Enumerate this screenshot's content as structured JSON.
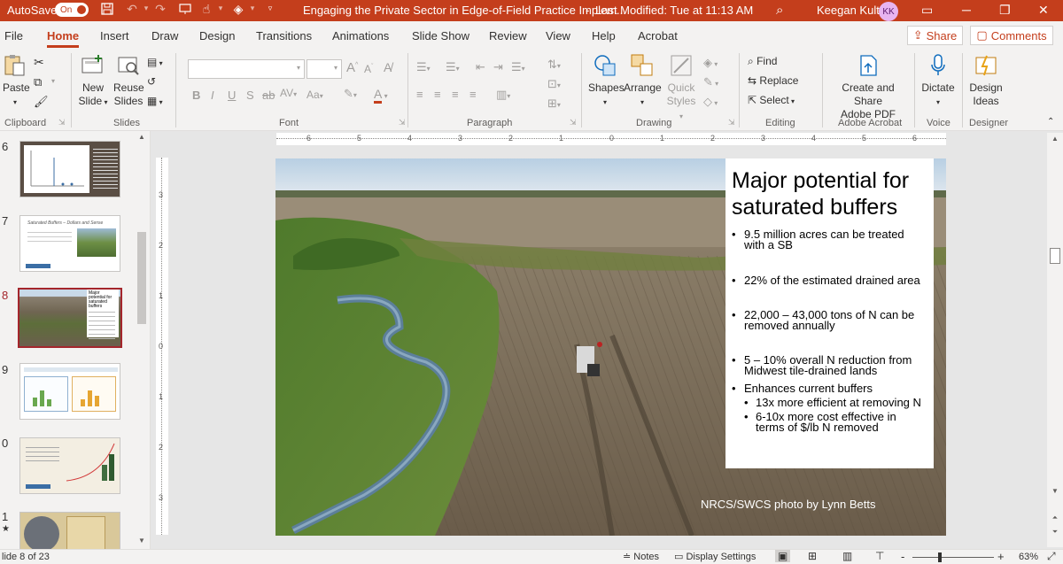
{
  "titlebar": {
    "autosave_label": "AutoSave",
    "autosave_state": "On",
    "doc_title": "Engaging the Private Sector in Edge-of-Field Practice Implem...",
    "sep": "-",
    "last_modified": "Last Modified: Tue at 11:13 AM",
    "user_name": "Keegan Kult",
    "user_initials": "KK"
  },
  "tabs": [
    "File",
    "Home",
    "Insert",
    "Draw",
    "Design",
    "Transitions",
    "Animations",
    "Slide Show",
    "Review",
    "View",
    "Help",
    "Acrobat"
  ],
  "active_tab": "Home",
  "share_label": "Share",
  "comments_label": "Comments",
  "ribbon": {
    "paste": "Paste",
    "new_slide_1": "New",
    "new_slide_2": "Slide",
    "reuse_1": "Reuse",
    "reuse_2": "Slides",
    "font_grow": "A",
    "font_shrink": "A",
    "shapes": "Shapes",
    "arrange": "Arrange",
    "quick_styles_1": "Quick",
    "quick_styles_2": "Styles",
    "find": "Find",
    "replace": "Replace",
    "select": "Select",
    "create_share_1": "Create and Share",
    "create_share_2": "Adobe PDF",
    "dictate": "Dictate",
    "design_ideas_1": "Design",
    "design_ideas_2": "Ideas",
    "groups": {
      "clipboard": "Clipboard",
      "slides": "Slides",
      "font": "Font",
      "paragraph": "Paragraph",
      "drawing": "Drawing",
      "editing": "Editing",
      "acrobat": "Adobe Acrobat",
      "voice": "Voice",
      "designer": "Designer"
    }
  },
  "thumbnails": [
    {
      "num": "6"
    },
    {
      "num": "7",
      "title": "Saturated Buffers – Dollars and Sense"
    },
    {
      "num": "8",
      "title": "Major potential for saturated buffers"
    },
    {
      "num": "9"
    },
    {
      "num": "0"
    },
    {
      "num": "1"
    }
  ],
  "ruler": {
    "h": [
      "6",
      "5",
      "4",
      "3",
      "2",
      "1",
      "0",
      "1",
      "2",
      "3",
      "4",
      "5",
      "6"
    ],
    "v": [
      "3",
      "2",
      "1",
      "0",
      "1",
      "2",
      "3"
    ]
  },
  "slide": {
    "title": "Major potential for saturated buffers",
    "bullets": [
      "9.5 million acres can be treated with a SB",
      "22% of the estimated drained area",
      "22,000 – 43,000 tons of N can be removed annually",
      "5 – 10% overall N reduction from Midwest tile-drained lands",
      "Enhances current buffers"
    ],
    "sub_bullets": [
      "13x more efficient at removing N",
      "6-10x more cost effective in terms of $/lb N removed"
    ],
    "caption": "NRCS/SWCS photo by Lynn Betts"
  },
  "status": {
    "slide_info": "lide 8 of 23",
    "notes": "Notes",
    "display_settings": "Display Settings",
    "zoom_minus": "-",
    "zoom_plus": "+",
    "zoom_pct": "63%",
    "zoom_level": 0.63
  },
  "colors": {
    "accent": "#c43e1c",
    "selection": "#a4262c"
  }
}
